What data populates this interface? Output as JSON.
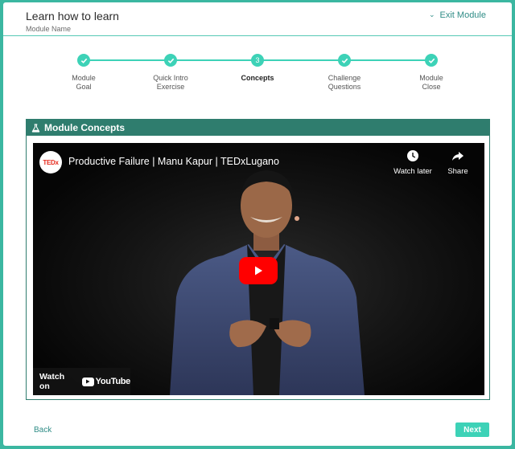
{
  "header": {
    "title": "Learn how to learn",
    "subtitle": "Module Name",
    "exit_label": "Exit Module"
  },
  "stepper": {
    "steps": [
      {
        "label": "Module\nGoal",
        "state": "done",
        "marker": ""
      },
      {
        "label": "Quick Intro\nExercise",
        "state": "done",
        "marker": ""
      },
      {
        "label": "Concepts",
        "state": "active",
        "marker": "3"
      },
      {
        "label": "Challenge\nQuestions",
        "state": "done",
        "marker": ""
      },
      {
        "label": "Module\nClose",
        "state": "done",
        "marker": ""
      }
    ]
  },
  "panel": {
    "title": "Module Concepts",
    "video": {
      "channel_logo": "TEDx",
      "title": "Productive Failure | Manu Kapur | TEDxLugano",
      "watch_later": "Watch later",
      "share": "Share",
      "watch_on": "Watch on",
      "platform": "YouTube"
    }
  },
  "footer": {
    "back_label": "Back",
    "next_label": "Next"
  },
  "colors": {
    "accent": "#3dd2b7",
    "panel_header": "#2f7d6e",
    "link": "#2f8c86",
    "frame_bg": "#3bb7a1"
  }
}
